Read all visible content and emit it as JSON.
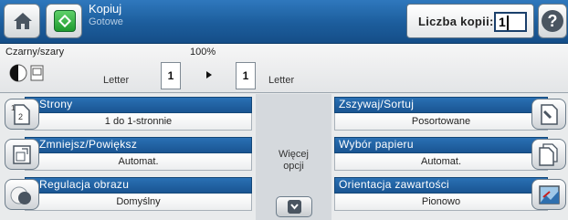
{
  "header": {
    "title": "Kopiuj",
    "subtitle": "Gotowe",
    "copies_label": "Liczba kopii:",
    "copies_value": "1",
    "home_icon": "home-icon",
    "copy_icon": "copy-app-icon",
    "help_icon": "help-icon"
  },
  "status": {
    "color_mode": "Czarny/szary",
    "zoom": "100%",
    "source_paper": "Letter",
    "source_sides": "1",
    "output_sides": "1",
    "output_paper": "Letter"
  },
  "options": {
    "left": [
      {
        "label": "Strony",
        "value": "1 do 1-stronnie",
        "icon": "pages-icon"
      },
      {
        "label": "Zmniejsz/Powiększ",
        "value": "Automat.",
        "icon": "reduce-enlarge-icon"
      },
      {
        "label": "Regulacja obrazu",
        "value": "Domyślny",
        "icon": "image-adjust-icon"
      }
    ],
    "right": [
      {
        "label": "Zszywaj/Sortuj",
        "value": "Posortowane",
        "icon": "staple-collate-icon"
      },
      {
        "label": "Wybór papieru",
        "value": "Automat.",
        "icon": "paper-select-icon"
      },
      {
        "label": "Orientacja zawartości",
        "value": "Pionowo",
        "icon": "content-orientation-icon"
      }
    ]
  },
  "more": {
    "label_line1": "Więcej",
    "label_line2": "opcji"
  }
}
